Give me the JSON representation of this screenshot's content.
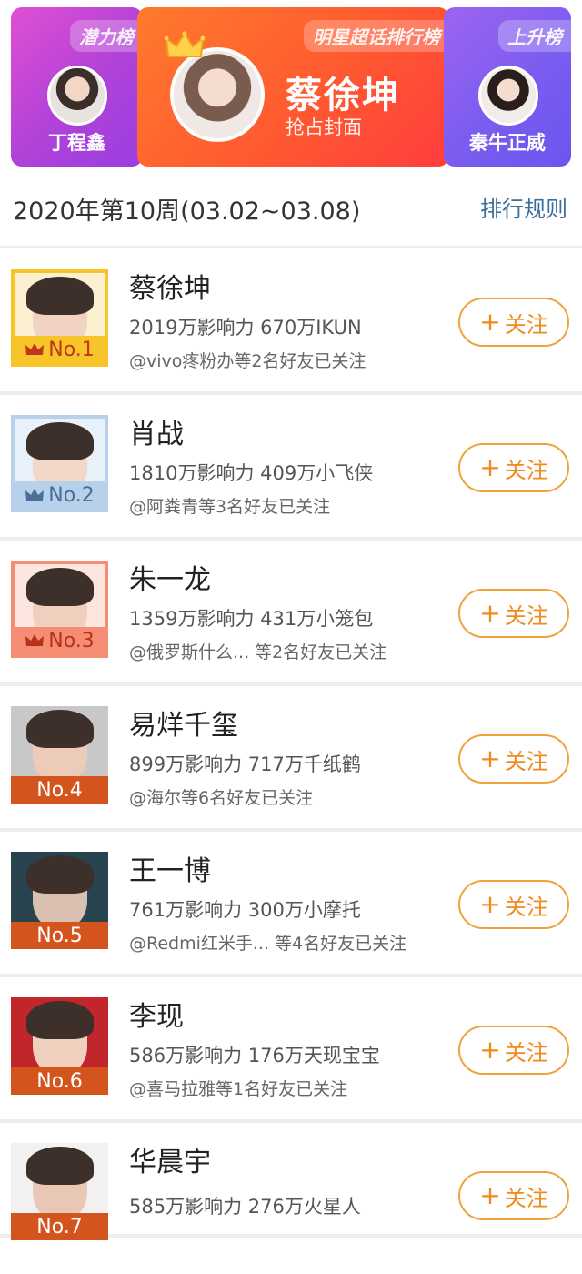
{
  "banners": {
    "left": {
      "tag": "潜力榜",
      "name": "丁程鑫"
    },
    "middle": {
      "tag": "明星超话排行榜",
      "name": "蔡徐坤",
      "subtitle": "抢占封面"
    },
    "right": {
      "tag": "上升榜",
      "name": "秦牛正威"
    }
  },
  "week": {
    "title": "2020年第10周(03.02~03.08)",
    "rules_label": "排行规则"
  },
  "follow_label": "关注",
  "follow_plus": "+",
  "ranks": [
    {
      "rank": "No.1",
      "tier": "gold",
      "name": "蔡徐坤",
      "stats": "2019万影响力 670万IKUN",
      "friends": "@vivo疼粉办等2名好友已关注"
    },
    {
      "rank": "No.2",
      "tier": "silver",
      "name": "肖战",
      "stats": "1810万影响力 409万小飞侠",
      "friends": "@阿粪青等3名好友已关注"
    },
    {
      "rank": "No.3",
      "tier": "bronze",
      "name": "朱一龙",
      "stats": "1359万影响力 431万小笼包",
      "friends": "@俄罗斯什么...  等2名好友已关注"
    },
    {
      "rank": "No.4",
      "tier": "plain",
      "name": "易烊千玺",
      "stats": "899万影响力 717万千纸鹤",
      "friends": "@海尔等6名好友已关注"
    },
    {
      "rank": "No.5",
      "tier": "plain",
      "name": "王一博",
      "stats": "761万影响力 300万小摩托",
      "friends": "@Redmi红米手... 等4名好友已关注"
    },
    {
      "rank": "No.6",
      "tier": "plain",
      "name": "李现",
      "stats": "586万影响力 176万天现宝宝",
      "friends": "@喜马拉雅等1名好友已关注"
    },
    {
      "rank": "No.7",
      "tier": "plain",
      "name": "华晨宇",
      "stats": "585万影响力 276万火星人",
      "friends": ""
    }
  ],
  "colors": {
    "follow_accent": "#f08a1c",
    "gold": "#f7c52a",
    "silver": "#b7d1ea",
    "bronze": "#f58c74",
    "plain_badge": "#d4541e",
    "rules_link": "#3b6e9a"
  },
  "icons": {
    "crown": "crown-icon",
    "plus": "plus-icon"
  }
}
